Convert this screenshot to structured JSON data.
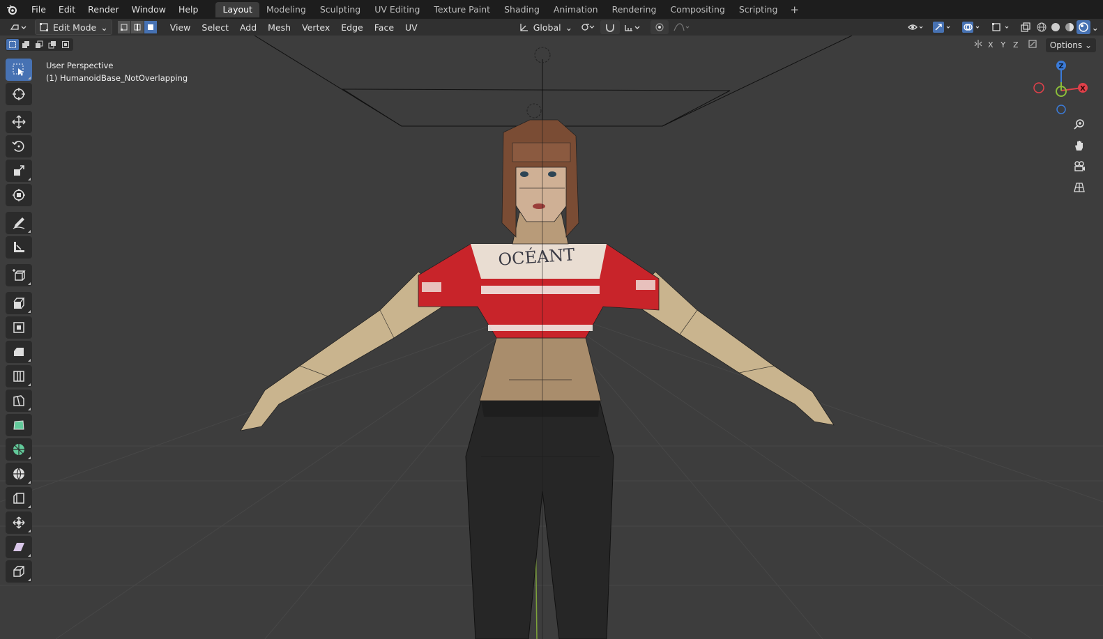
{
  "menu": [
    "File",
    "Edit",
    "Render",
    "Window",
    "Help"
  ],
  "workspaces": [
    "Layout",
    "Modeling",
    "Sculpting",
    "UV Editing",
    "Texture Paint",
    "Shading",
    "Animation",
    "Rendering",
    "Compositing",
    "Scripting"
  ],
  "active_workspace": "Layout",
  "header": {
    "mode": "Edit Mode",
    "menus": [
      "View",
      "Select",
      "Add",
      "Mesh",
      "Vertex",
      "Edge",
      "Face",
      "UV"
    ],
    "orientation": "Global"
  },
  "viewport": {
    "perspective": "User Perspective",
    "object": "(1) HumanoidBase_NotOverlapping",
    "shirt_text": "OCÉANT"
  },
  "axis": {
    "x": "X",
    "y": "Y",
    "z": "Z"
  },
  "options_label": "Options",
  "colors": {
    "accent": "#4772b3",
    "x_axis": "#e0404a",
    "y_axis": "#8bbd3a",
    "z_axis": "#3b7bd8"
  }
}
